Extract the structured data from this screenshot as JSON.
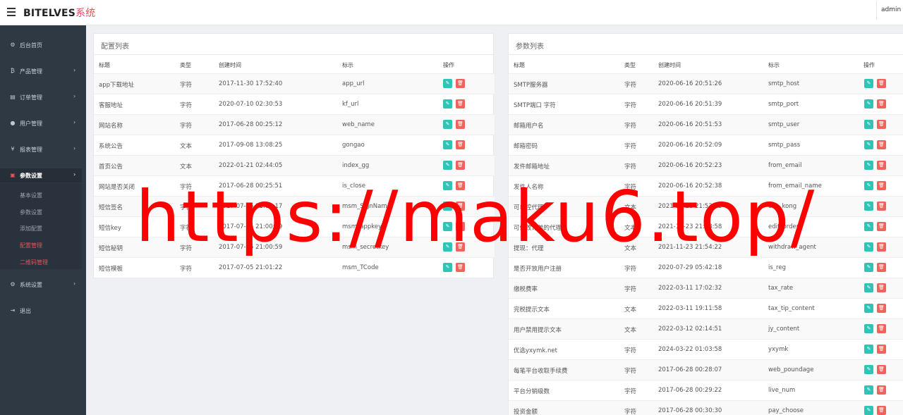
{
  "header": {
    "brand_main": "BITELVES",
    "brand_accent": "系统",
    "user": "admin"
  },
  "sidebar": {
    "items": [
      {
        "icon": "dashboard-icon",
        "glyph": "⚙",
        "label": "后台首页",
        "chevron": ""
      },
      {
        "icon": "bitcoin-icon",
        "glyph": "₿",
        "label": "产品管理",
        "chevron": "›"
      },
      {
        "icon": "orders-icon",
        "glyph": "▤",
        "label": "订单管理",
        "chevron": "›"
      },
      {
        "icon": "user-icon",
        "glyph": "●",
        "label": "用户管理",
        "chevron": "›"
      },
      {
        "icon": "yen-icon",
        "glyph": "¥",
        "label": "报表管理",
        "chevron": "›"
      },
      {
        "icon": "settings-icon",
        "glyph": "▣",
        "label": "参数设置",
        "chevron": "›"
      },
      {
        "icon": "cogs-icon",
        "glyph": "⚙",
        "label": "系统设置",
        "chevron": "›"
      },
      {
        "icon": "logout-icon",
        "glyph": "⇥",
        "label": "退出",
        "chevron": ""
      }
    ],
    "submenu": [
      "基本设置",
      "参数设置",
      "添加配置",
      "配置管理",
      "二维码管理"
    ]
  },
  "config_panel": {
    "title": "配置列表",
    "headers": [
      "标题",
      "类型",
      "创建时间",
      "标示",
      "操作"
    ],
    "rows": [
      [
        "app下载地址",
        "字符",
        "2017-11-30 17:52:40",
        "app_url"
      ],
      [
        "客服地址",
        "字符",
        "2020-07-10 02:30:53",
        "kf_url"
      ],
      [
        "网站名称",
        "字符",
        "2017-06-28 00:25:12",
        "web_name"
      ],
      [
        "系统公告",
        "文本",
        "2017-09-08 13:08:25",
        "gongao"
      ],
      [
        "首页公告",
        "文本",
        "2022-01-21 02:44:05",
        "index_gg"
      ],
      [
        "网站是否关闭",
        "字符",
        "2017-06-28 00:25:51",
        "is_close"
      ],
      [
        "短信签名",
        "字符",
        "2017-07-05 21:00:17",
        "msm_SignName"
      ],
      [
        "短信key",
        "字符",
        "2017-07-05 21:00:39",
        "msm_appkey"
      ],
      [
        "短信秘钥",
        "字符",
        "2017-07-05 21:00:59",
        "msm_secretkey"
      ],
      [
        "短信模板",
        "字符",
        "2017-07-05 21:01:22",
        "msm_TCode"
      ]
    ]
  },
  "param_panel": {
    "title": "参数列表",
    "headers": [
      "标题",
      "类型",
      "创建时间",
      "标示",
      "操作"
    ],
    "rows": [
      [
        "SMTP服务器",
        "字符",
        "2020-06-16 20:51:26",
        "smtp_host"
      ],
      [
        "SMTP端口 字符",
        "字符",
        "2020-06-16 20:51:39",
        "smtp_port"
      ],
      [
        "邮箱用户名",
        "字符",
        "2020-06-16 20:51:53",
        "smtp_user"
      ],
      [
        "邮箱密码",
        "字符",
        "2020-06-16 20:52:09",
        "smtp_pass"
      ],
      [
        "发件邮箱地址",
        "字符",
        "2020-06-16 20:52:23",
        "from_email"
      ],
      [
        "发件人名称",
        "字符",
        "2020-06-16 20:52:38",
        "from_email_name"
      ],
      [
        "可单控代理",
        "文本",
        "2021-11-23 21:53:12",
        "can_kong"
      ],
      [
        "可修改订单的代理",
        "文本",
        "2021-11-23 21:53:58",
        "edit_order"
      ],
      [
        "提现：代理",
        "文本",
        "2021-11-23 21:54:22",
        "withdraw_agent"
      ],
      [
        "是否开放用户注册",
        "字符",
        "2020-07-29 05:42:18",
        "is_reg"
      ],
      [
        "缴税费率",
        "字符",
        "2022-03-11 17:02:32",
        "tax_rate"
      ],
      [
        "完税提示文本",
        "文本",
        "2022-03-11 19:11:58",
        "tax_tip_content"
      ],
      [
        "用户禁用提示文本",
        "文本",
        "2022-03-12 02:14:51",
        "jy_content"
      ],
      [
        "优选yxymk.net",
        "字符",
        "2024-03-22 01:03:58",
        "yxymk"
      ],
      [
        "每笔平台收取手续费",
        "字符",
        "2017-06-28 00:28:07",
        "web_poundage"
      ],
      [
        "平台分销级数",
        "字符",
        "2017-06-28 00:29:22",
        "live_num"
      ],
      [
        "投资金额",
        "字符",
        "2017-06-28 00:30:30",
        "pay_choose"
      ]
    ]
  },
  "actions": {
    "edit_glyph": "✎",
    "delete_glyph": "🗑"
  },
  "colors": {
    "accent": "#e8505b",
    "edit": "#2ec4b6",
    "delete": "#f0625a",
    "sidebar": "#2f3944"
  },
  "watermark": "https://maku6.top/"
}
